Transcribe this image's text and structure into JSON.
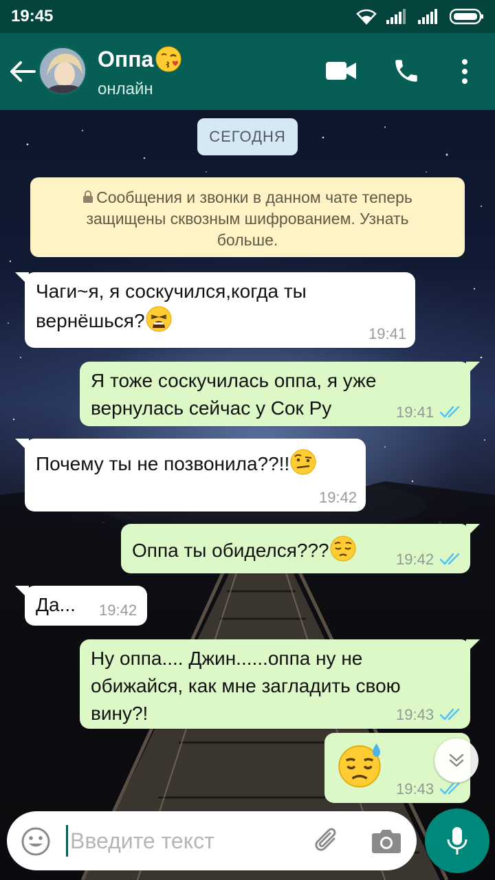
{
  "status_bar": {
    "time": "19:45"
  },
  "header": {
    "contact_name": "Оппа",
    "contact_status": "онлайн"
  },
  "chat": {
    "date_chip": "СЕГОДНЯ",
    "encryption_notice": "Сообщения и звонки в данном чате теперь\nзащищены сквозным шифрованием. Узнать\nбольше.",
    "messages": [
      {
        "direction": "in",
        "text": "Чаги~я, я соскучился,когда ты\nвернёшься?",
        "emoji": "weary-face",
        "time": "19:41"
      },
      {
        "direction": "out",
        "text": "Я тоже соскучилась оппа, я уже\nвернулась сейчас у Сок Ру",
        "time": "19:41",
        "status": "read"
      },
      {
        "direction": "in",
        "text": "Почему ты не позвонила??!!",
        "emoji": "raised-eyebrow-face",
        "time": "19:42"
      },
      {
        "direction": "out",
        "text": "Оппа ты обиделся???",
        "emoji": "pensive-face",
        "time": "19:42",
        "status": "read"
      },
      {
        "direction": "in",
        "text": "Да...",
        "time": "19:42"
      },
      {
        "direction": "out",
        "text": "Ну оппа.... Джин......оппа ну не\nобижайся, как мне загладить свою\nвину?!",
        "time": "19:43",
        "status": "read"
      },
      {
        "direction": "out",
        "text": "",
        "emoji": "downcast-sweat-face",
        "time": "19:43",
        "status": "read"
      }
    ]
  },
  "input": {
    "placeholder": "Введите текст",
    "value": ""
  },
  "colors": {
    "app_bar": "#075e54",
    "status_bar": "#04443c",
    "incoming_bubble": "#ffffff",
    "outgoing_bubble": "#dcf8c6",
    "read_ticks": "#4fc3f7",
    "mic_button": "#00897b"
  }
}
